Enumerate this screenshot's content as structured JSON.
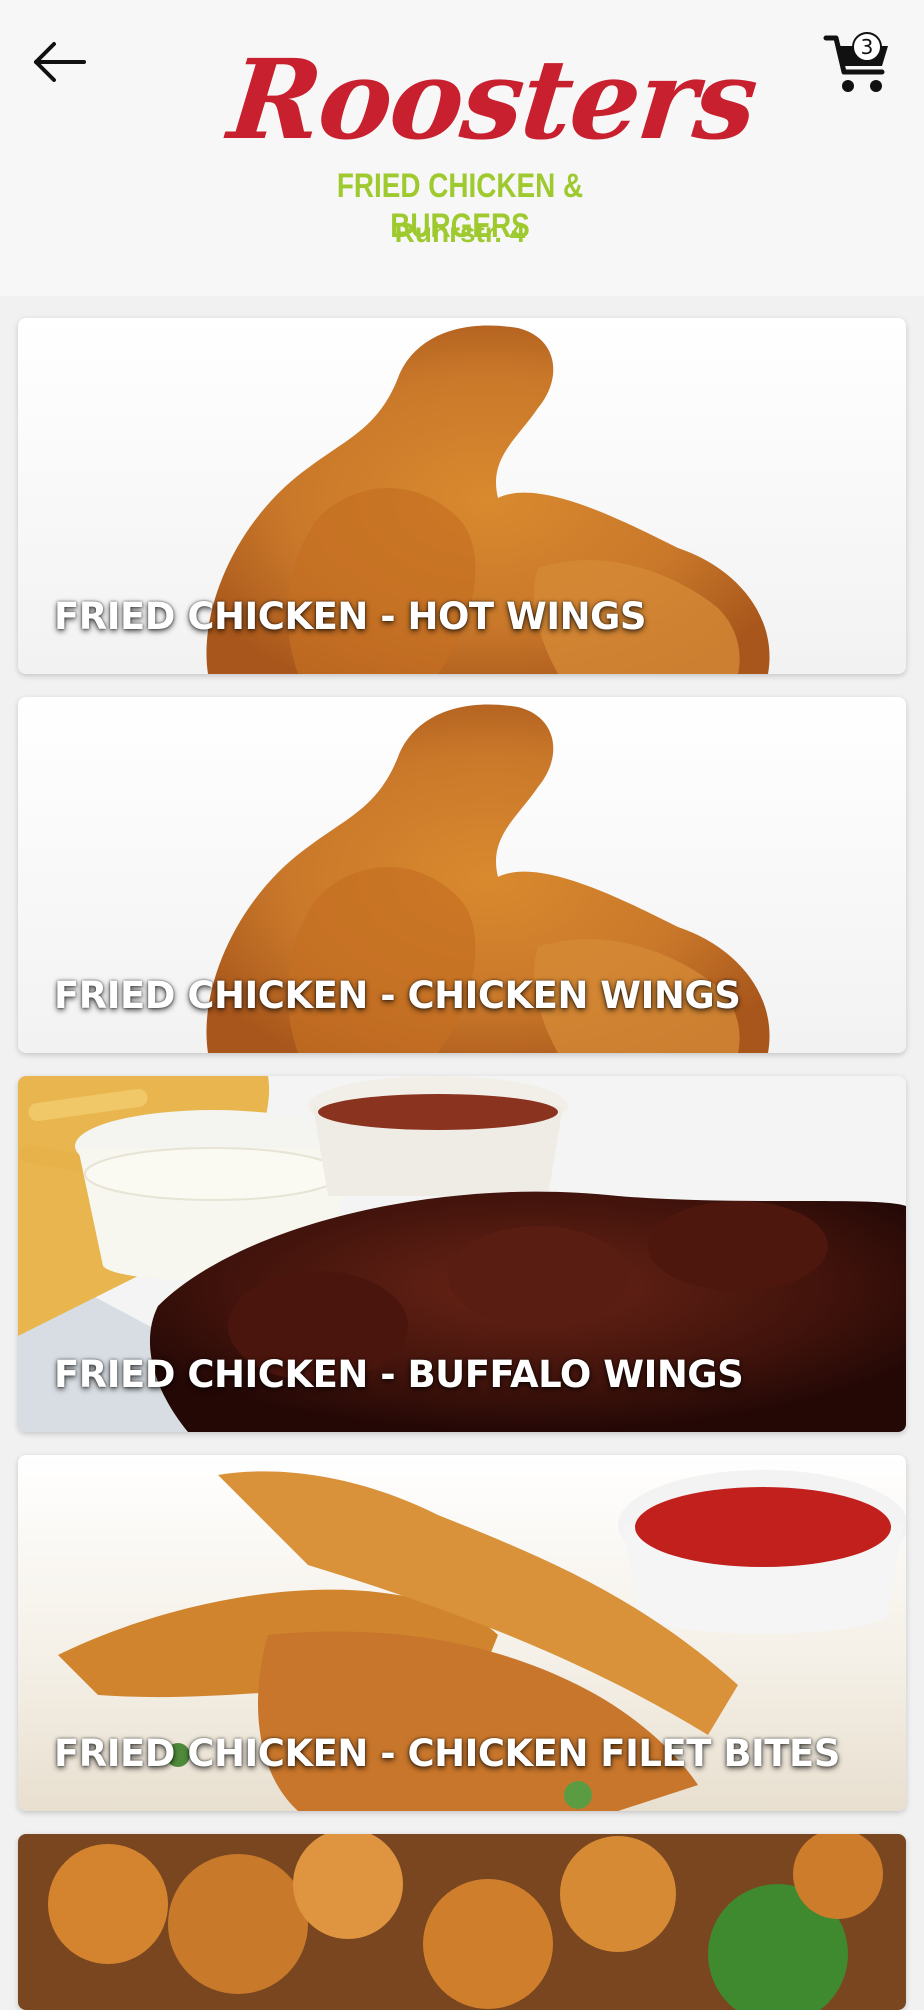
{
  "header": {
    "brand": "Roosters",
    "tagline": "FRIED CHICKEN & BURGERS",
    "address": "Ruhrstr. 4",
    "cart_count": "3",
    "brand_color": "#c8202f",
    "accent_color": "#9fca2f",
    "back_icon": "arrow-left-icon",
    "cart_icon": "shopping-cart-icon"
  },
  "categories": [
    {
      "title": "FRIED CHICKEN - HOT WINGS"
    },
    {
      "title": "FRIED CHICKEN - CHICKEN WINGS"
    },
    {
      "title": "FRIED CHICKEN - BUFFALO WINGS"
    },
    {
      "title": "FRIED CHICKEN - CHICKEN FILET BITES"
    },
    {
      "title": ""
    }
  ]
}
